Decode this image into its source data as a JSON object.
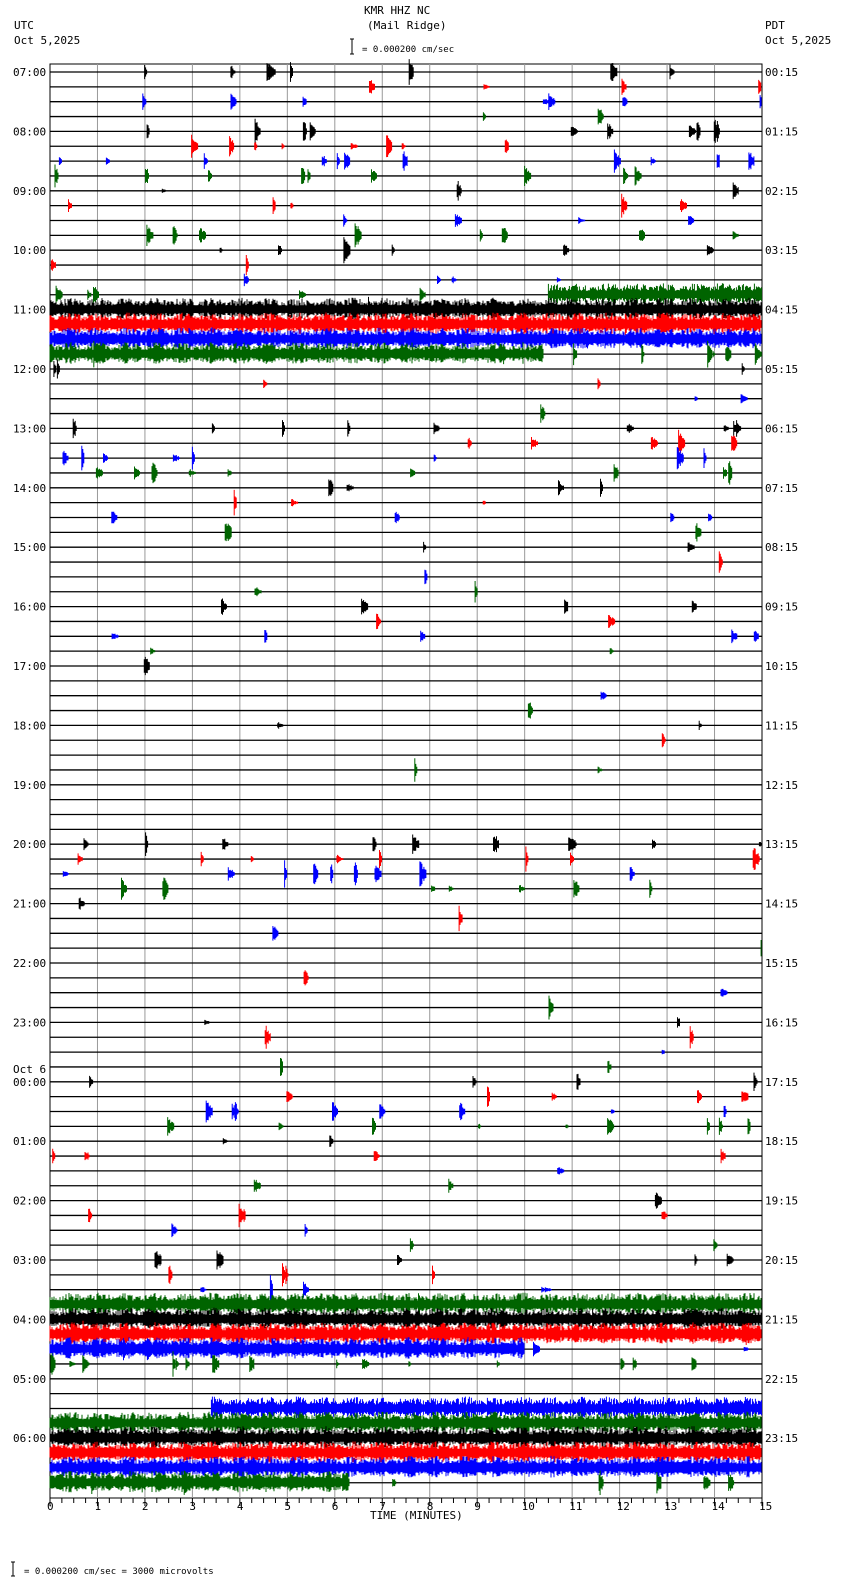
{
  "header": {
    "station": "KMR HHZ NC",
    "location": "(Mail Ridge)",
    "left_tz": "UTC",
    "left_date": "Oct 5,2025",
    "right_tz": "PDT",
    "right_date": "Oct 5,2025",
    "scale_text": "= 0.000200 cm/sec"
  },
  "footer": {
    "scale_text": "= 0.000200 cm/sec =    3000 microvolts"
  },
  "chart_data": {
    "type": "helicorder",
    "xlabel": "TIME (MINUTES)",
    "xlim": [
      0,
      15
    ],
    "x_ticks": [
      "0",
      "1",
      "2",
      "3",
      "4",
      "5",
      "6",
      "7",
      "8",
      "9",
      "10",
      "11",
      "12",
      "13",
      "14",
      "15"
    ],
    "rows_per_hour": 4,
    "trace_colors": [
      "#000000",
      "#ff0000",
      "#0000ff",
      "#006400"
    ],
    "left_labels": [
      "07:00",
      "08:00",
      "09:00",
      "10:00",
      "11:00",
      "12:00",
      "13:00",
      "14:00",
      "15:00",
      "16:00",
      "17:00",
      "18:00",
      "19:00",
      "20:00",
      "21:00",
      "22:00",
      "23:00",
      "00:00",
      "01:00",
      "02:00",
      "03:00",
      "04:00",
      "05:00",
      "06:00"
    ],
    "date_change_label": "Oct 6",
    "right_labels": [
      "00:15",
      "01:15",
      "02:15",
      "03:15",
      "04:15",
      "05:15",
      "06:15",
      "07:15",
      "08:15",
      "09:15",
      "10:15",
      "11:15",
      "12:15",
      "13:15",
      "14:15",
      "15:15",
      "16:15",
      "17:15",
      "18:15",
      "19:15",
      "20:15",
      "21:15",
      "22:15",
      "23:15"
    ],
    "activity_per_hour": [
      0.6,
      0.6,
      0.6,
      0.4,
      1.0,
      0.3,
      0.6,
      0.5,
      0.2,
      0.4,
      0.05,
      0.1,
      0.0,
      0.7,
      0.1,
      0.05,
      0.15,
      0.5,
      0.2,
      0.15,
      0.4,
      1.0,
      0.0,
      1.0
    ],
    "noise_segments": [
      {
        "row": 15,
        "from_min": 10.5,
        "to_min": 15
      },
      {
        "row": 16,
        "from_min": 0,
        "to_min": 15
      },
      {
        "row": 17,
        "from_min": 0,
        "to_min": 15
      },
      {
        "row": 18,
        "from_min": 0,
        "to_min": 15
      },
      {
        "row": 19,
        "from_min": 0,
        "to_min": 10.4
      },
      {
        "row": 83,
        "from_min": 0,
        "to_min": 15
      },
      {
        "row": 84,
        "from_min": 0,
        "to_min": 15
      },
      {
        "row": 85,
        "from_min": 0,
        "to_min": 15
      },
      {
        "row": 86,
        "from_min": 0,
        "to_min": 10
      },
      {
        "row": 90,
        "from_min": 3.4,
        "to_min": 15
      },
      {
        "row": 91,
        "from_min": 0,
        "to_min": 15
      },
      {
        "row": 92,
        "from_min": 0,
        "to_min": 15
      },
      {
        "row": 93,
        "from_min": 0,
        "to_min": 15
      },
      {
        "row": 94,
        "from_min": 0,
        "to_min": 15
      },
      {
        "row": 95,
        "from_min": 0,
        "to_min": 6.3
      }
    ]
  }
}
